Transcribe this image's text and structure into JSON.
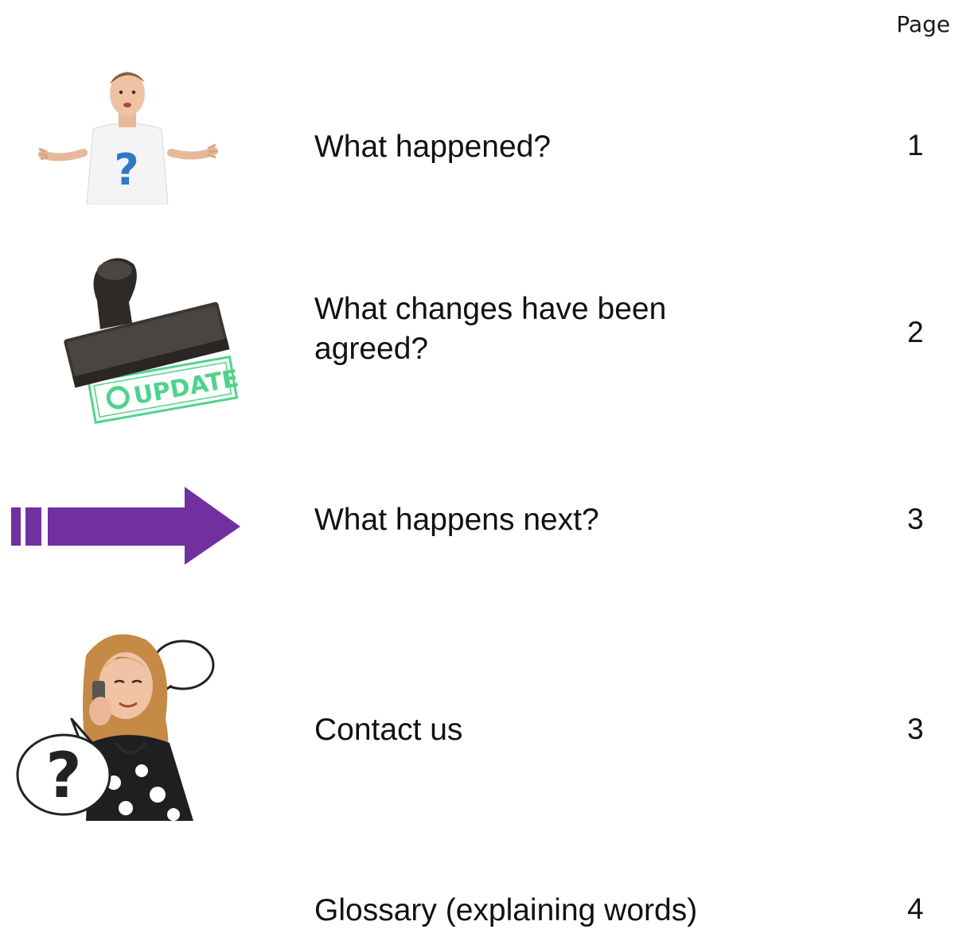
{
  "header": {
    "page_label": "Page"
  },
  "toc": [
    {
      "title": "What happened?",
      "page": "1",
      "icon": "confused-man-question-icon"
    },
    {
      "title": "What changes have been agreed?",
      "page": "2",
      "icon": "update-stamp-icon"
    },
    {
      "title": "What happens next?",
      "page": "3",
      "icon": "next-arrow-icon"
    },
    {
      "title": "Contact us",
      "page": "3",
      "icon": "woman-phone-speech-bubble-icon"
    },
    {
      "title": "Glossary (explaining words)",
      "page": "4",
      "icon": ""
    }
  ],
  "stamp_text": "UPDATE",
  "colors": {
    "arrow_purple": "#7030a0",
    "stamp_green": "#4fd38c",
    "shirt_question_blue": "#2f78c4"
  }
}
